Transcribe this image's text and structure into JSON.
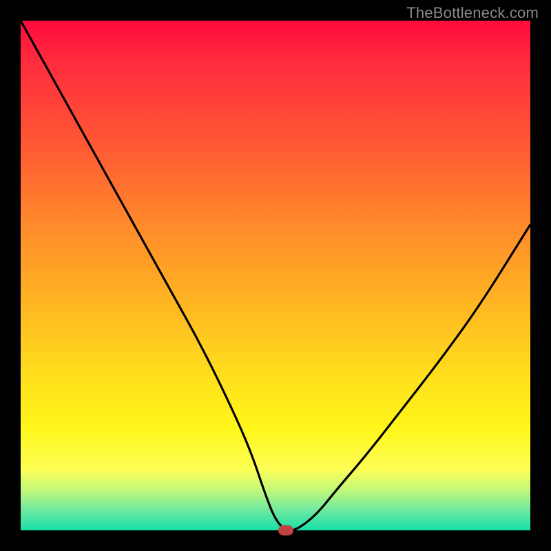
{
  "watermark": "TheBottleneck.com",
  "colors": {
    "frame": "#000000",
    "curve": "#000000",
    "marker": "#c04343",
    "gradient_top": "#ff0a3c",
    "gradient_bottom": "#17e0a7"
  },
  "chart_data": {
    "type": "line",
    "title": "",
    "xlabel": "",
    "ylabel": "",
    "xlim": [
      0,
      100
    ],
    "ylim": [
      0,
      100
    ],
    "grid": false,
    "legend": false,
    "annotations": [
      {
        "type": "marker",
        "x": 52,
        "y": 0,
        "color": "#c04343"
      }
    ],
    "series": [
      {
        "name": "bottleneck-curve",
        "x": [
          0,
          5,
          10,
          15,
          20,
          25,
          30,
          35,
          40,
          45,
          48,
          50,
          52,
          54,
          58,
          62,
          68,
          75,
          82,
          90,
          100
        ],
        "values": [
          100,
          91,
          82,
          73,
          64,
          55,
          46,
          37,
          27,
          16,
          7,
          2,
          0,
          0,
          3,
          8,
          15,
          24,
          33,
          44,
          60
        ]
      }
    ]
  }
}
